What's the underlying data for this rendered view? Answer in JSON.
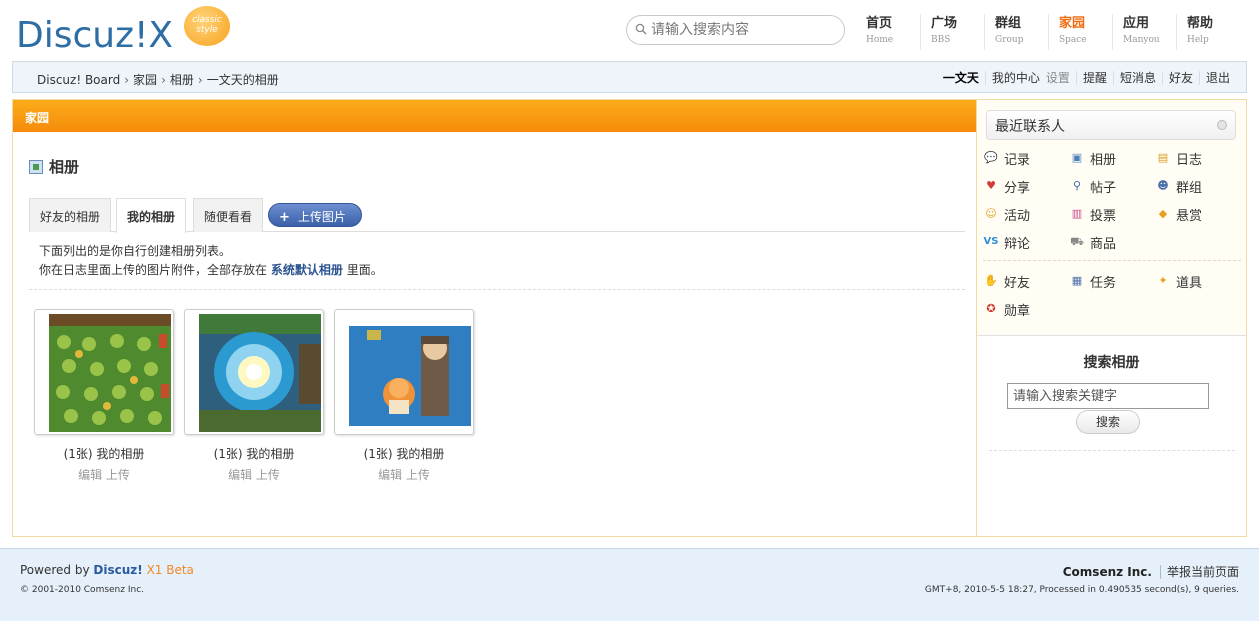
{
  "logo": {
    "text": "Discuz!X",
    "badge": "classic style"
  },
  "search": {
    "placeholder": "请输入搜索内容"
  },
  "nav": [
    {
      "zh": "首页",
      "en": "Home"
    },
    {
      "zh": "广场",
      "en": "BBS"
    },
    {
      "zh": "群组",
      "en": "Group"
    },
    {
      "zh": "家园",
      "en": "Space"
    },
    {
      "zh": "应用",
      "en": "Manyou"
    },
    {
      "zh": "帮助",
      "en": "Help"
    }
  ],
  "breadcrumb": [
    "Discuz! Board",
    "家园",
    "相册",
    "一文天的相册"
  ],
  "user_menu": {
    "username": "一文天",
    "center": "我的中心",
    "settings": "设置",
    "remind": "提醒",
    "messages": "短消息",
    "friends": "好友",
    "logout": "退出"
  },
  "main": {
    "section_title": "家园",
    "heading": "相册",
    "tabs": [
      "好友的相册",
      "我的相册",
      "随便看看"
    ],
    "upload_label": "上传图片",
    "note_line1": "下面列出的是你自行创建相册列表。",
    "note_line2_pre": "你在日志里面上传的图片附件，全部存放在",
    "note_line2_link": "系统默认相册",
    "note_line2_post": "里面。",
    "albums": [
      {
        "caption": "(1张) 我的相册",
        "edit": "编辑",
        "upload": "上传"
      },
      {
        "caption": "(1张) 我的相册",
        "edit": "编辑",
        "upload": "上传"
      },
      {
        "caption": "(1张) 我的相册",
        "edit": "编辑",
        "upload": "上传"
      }
    ]
  },
  "sidebar": {
    "recent_contacts": "最近联系人",
    "apps1": [
      {
        "label": "记录",
        "icon": "speech-bubble-icon"
      },
      {
        "label": "相册",
        "icon": "photo-icon"
      },
      {
        "label": "日志",
        "icon": "notebook-icon"
      },
      {
        "label": "分享",
        "icon": "hearts-icon"
      },
      {
        "label": "帖子",
        "icon": "magnifier-user-icon"
      },
      {
        "label": "群组",
        "icon": "group-icon"
      },
      {
        "label": "活动",
        "icon": "people-icon"
      },
      {
        "label": "投票",
        "icon": "bar-chart-icon"
      },
      {
        "label": "悬赏",
        "icon": "gold-icon"
      },
      {
        "label": "辩论",
        "icon": "vs-icon"
      },
      {
        "label": "商品",
        "icon": "cart-icon"
      }
    ],
    "apps2": [
      {
        "label": "好友",
        "icon": "handshake-icon"
      },
      {
        "label": "任务",
        "icon": "task-icon"
      },
      {
        "label": "道具",
        "icon": "wand-icon"
      },
      {
        "label": "勋章",
        "icon": "medal-icon"
      }
    ],
    "search_title": "搜索相册",
    "search_placeholder": "请输入搜索关键字",
    "search_button": "搜索"
  },
  "footer": {
    "powered_by": "Powered by",
    "product": "Discuz!",
    "version": "X1 Beta",
    "copyright": "© 2001-2010 Comsenz Inc.",
    "company": "Comsenz Inc.",
    "report": "举报当前页面",
    "processed": "GMT+8, 2010-5-5 18:27, Processed in 0.490535 second(s), 9 queries."
  },
  "colors": {
    "accent": "#f58b0a",
    "link": "#2b5491",
    "active_nav": "#f26c0f"
  }
}
